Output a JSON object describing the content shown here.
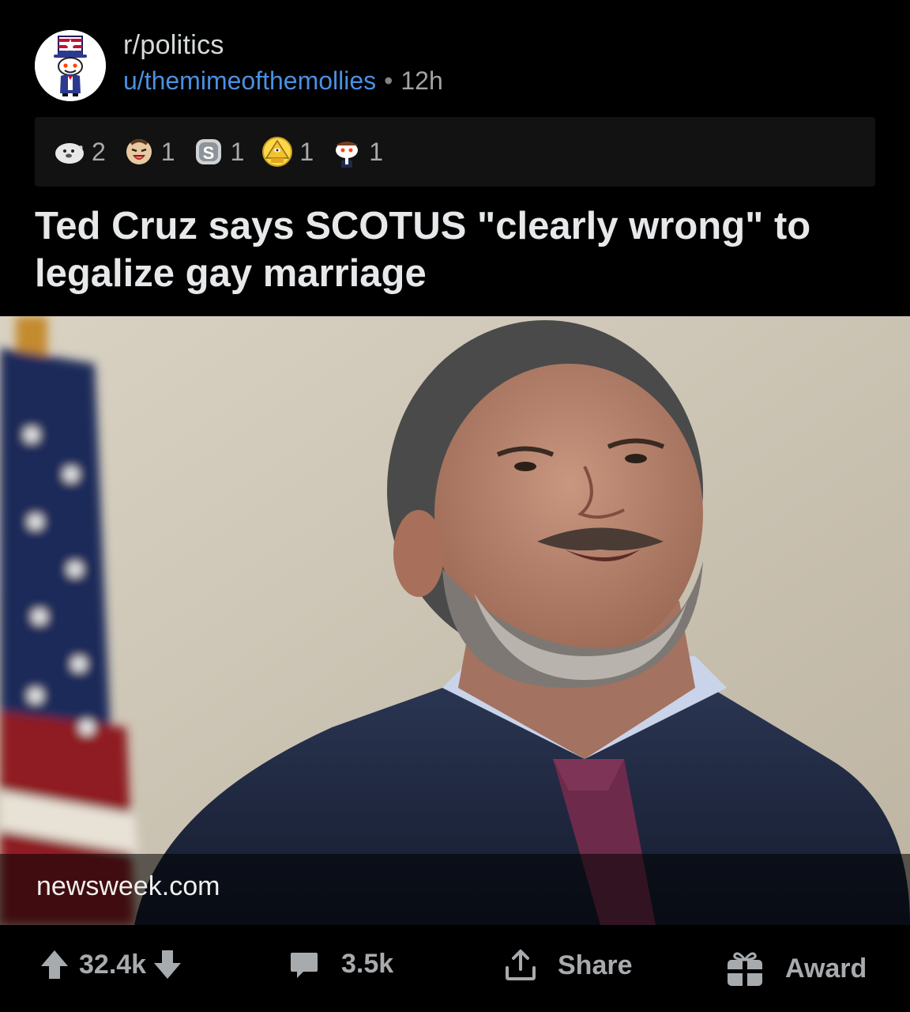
{
  "header": {
    "subreddit": "r/politics",
    "username": "u/themimeofthemollies",
    "separator": "•",
    "age": "12h"
  },
  "awards": [
    {
      "icon": "wholesome-seal-icon",
      "count": "2"
    },
    {
      "icon": "laughing-face-icon",
      "count": "1"
    },
    {
      "icon": "silver-coin-icon",
      "count": "1"
    },
    {
      "icon": "gold-pyramid-icon",
      "count": "1"
    },
    {
      "icon": "snoo-award-icon",
      "count": "1"
    }
  ],
  "post": {
    "title": "Ted Cruz says SCOTUS \"clearly wrong\" to legalize gay marriage",
    "link_domain": "newsweek.com"
  },
  "actions": {
    "votes": "32.4k",
    "comments": "3.5k",
    "share": "Share",
    "award": "Award"
  },
  "colors": {
    "background": "#000000",
    "username": "#4a90e2",
    "text": "#d7dadc",
    "muted": "#a8abae",
    "awards_bar": "#121212"
  }
}
